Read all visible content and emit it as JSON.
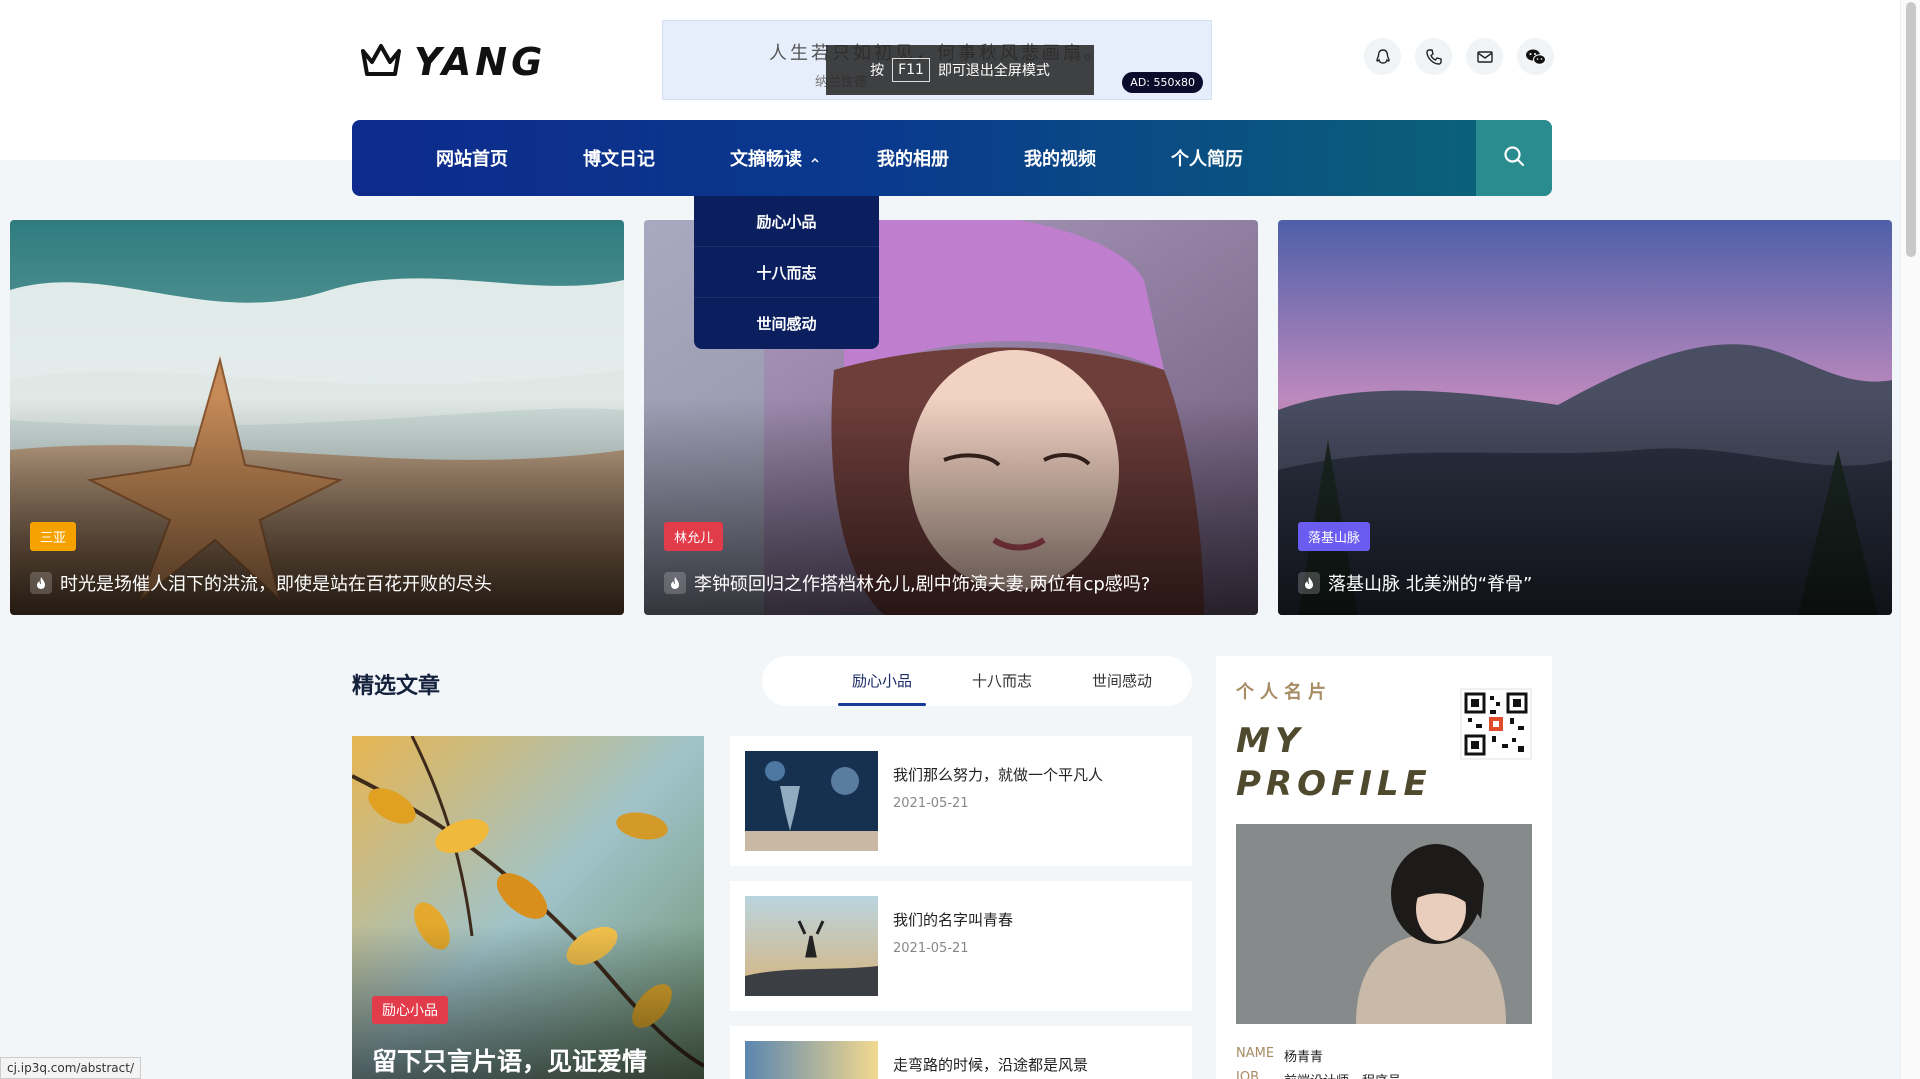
{
  "header": {
    "logo_text": "YANG",
    "ad_line1": "人生若只如初见，何事秋风悲画扇。",
    "ad_line2": "纳兰性德",
    "ad_badge": "AD: 550x80",
    "fullscreen_prefix": "按",
    "fullscreen_key": "F11",
    "fullscreen_suffix": "即可退出全屏模式",
    "social_icons": [
      "qq-icon",
      "phone-icon",
      "mail-icon",
      "wechat-icon"
    ]
  },
  "nav": {
    "items": [
      "网站首页",
      "博文日记",
      "文摘畅读",
      "我的相册",
      "我的视频",
      "个人简历"
    ],
    "dropdown": [
      "励心小品",
      "十八而志",
      "世间感动"
    ]
  },
  "hero": [
    {
      "tag": "三亚",
      "tag_color": "#f5a100",
      "caption": "时光是场催人泪下的洪流，即使是站在百花开败的尽头"
    },
    {
      "tag": "林允儿",
      "tag_color": "#e23b4a",
      "caption": "李钟硕回归之作搭档林允儿,剧中饰演夫妻,两位有cp感吗?"
    },
    {
      "tag": "落基山脉",
      "tag_color": "#6a5cf0",
      "caption": "落基山脉 北美洲的“脊骨”"
    }
  ],
  "featured": {
    "title": "精选文章",
    "tabs": [
      "励心小品",
      "十八而志",
      "世间感动"
    ],
    "big": {
      "tag": "励心小品",
      "title": "留下只言片语，见证爱情"
    },
    "items": [
      {
        "title": "我们那么努力，就做一个平凡人",
        "date": "2021-05-21"
      },
      {
        "title": "我们的名字叫青春",
        "date": "2021-05-21"
      },
      {
        "title": "走弯路的时候，沿途都是风景",
        "date": ""
      }
    ]
  },
  "profile": {
    "label": "个人名片",
    "my": "MY",
    "profile_word": "PROFILE",
    "name_key": "NAME",
    "name_value": "杨青青",
    "job_key": "JOB",
    "job_value": "前端设计师、程序员"
  },
  "status_url": "cj.ip3q.com/abstract/"
}
